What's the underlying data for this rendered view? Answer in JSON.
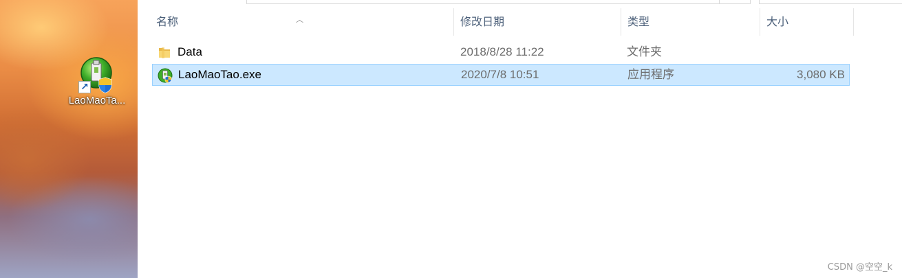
{
  "desktop": {
    "shortcut": {
      "label": "LaoMaoTa...",
      "icon": "laomaotao-app-icon"
    }
  },
  "explorer": {
    "columns": {
      "name": "名称",
      "date": "修改日期",
      "type": "类型",
      "size": "大小"
    },
    "files": [
      {
        "name": "Data",
        "date": "2018/8/28 11:22",
        "type": "文件夹",
        "size": "",
        "icon": "folder-icon",
        "selected": false
      },
      {
        "name": "LaoMaoTao.exe",
        "date": "2020/7/8 10:51",
        "type": "应用程序",
        "size": "3,080 KB",
        "icon": "laomaotao-app-icon",
        "selected": true
      }
    ],
    "selection_color": "#cce8ff",
    "selection_border": "#99d1ff"
  },
  "watermark": "CSDN @空空_k"
}
